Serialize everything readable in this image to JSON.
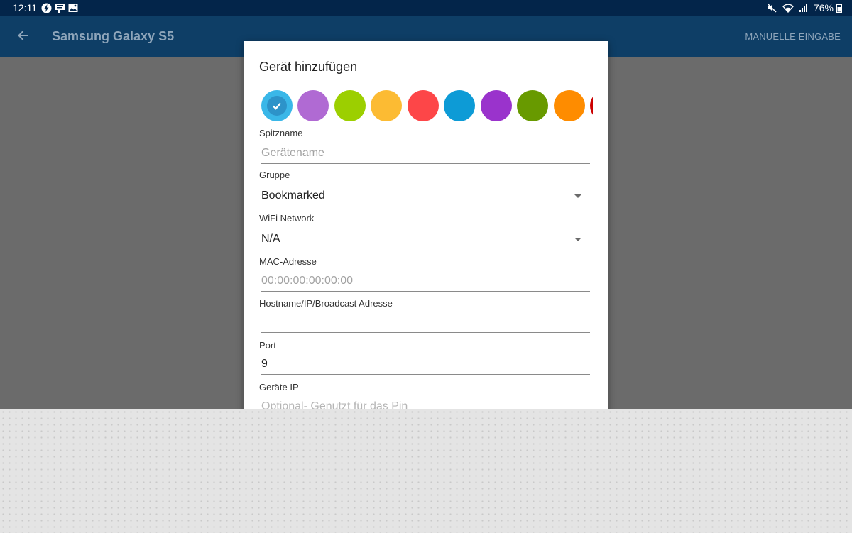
{
  "statusbar": {
    "time": "12:11",
    "left_icons": [
      "bolt-circle-icon",
      "notification-icon",
      "gallery-icon"
    ],
    "right_icons": [
      "mute-icon",
      "wifi-icon",
      "signal-icon",
      "battery-icon"
    ],
    "battery": "76%"
  },
  "appbar": {
    "back_icon": "back-arrow-icon",
    "title": "Samsung Galaxy S5",
    "action": "MANUELLE EINGABE"
  },
  "dialog": {
    "title": "Gerät hinzufügen",
    "colors": [
      "#3ab7e8",
      "#b06ad3",
      "#9ccf00",
      "#fcbb33",
      "#fd4648",
      "#0d9bd6",
      "#9a33cc",
      "#689a00",
      "#fe8c00",
      "#cc0000"
    ],
    "selected_color_index": 0,
    "fields": {
      "nickname": {
        "label": "Spitzname",
        "placeholder": "Gerätename",
        "value": ""
      },
      "group": {
        "label": "Gruppe",
        "value": "Bookmarked"
      },
      "wifi": {
        "label": "WiFi Network",
        "value": "N/A"
      },
      "mac": {
        "label": "MAC-Adresse",
        "placeholder": "00:00:00:00:00:00",
        "value": ""
      },
      "host": {
        "label": "Hostname/IP/Broadcast Adresse",
        "value": ""
      },
      "port": {
        "label": "Port",
        "value": "9"
      },
      "device_ip": {
        "label": "Geräte IP",
        "placeholder": "Optional- Genutzt für das Pin"
      }
    }
  },
  "colors": {
    "statusbar_bg": "#03254a",
    "appbar_bg": "#0e3e66",
    "scrim": "#6b6b6b"
  }
}
